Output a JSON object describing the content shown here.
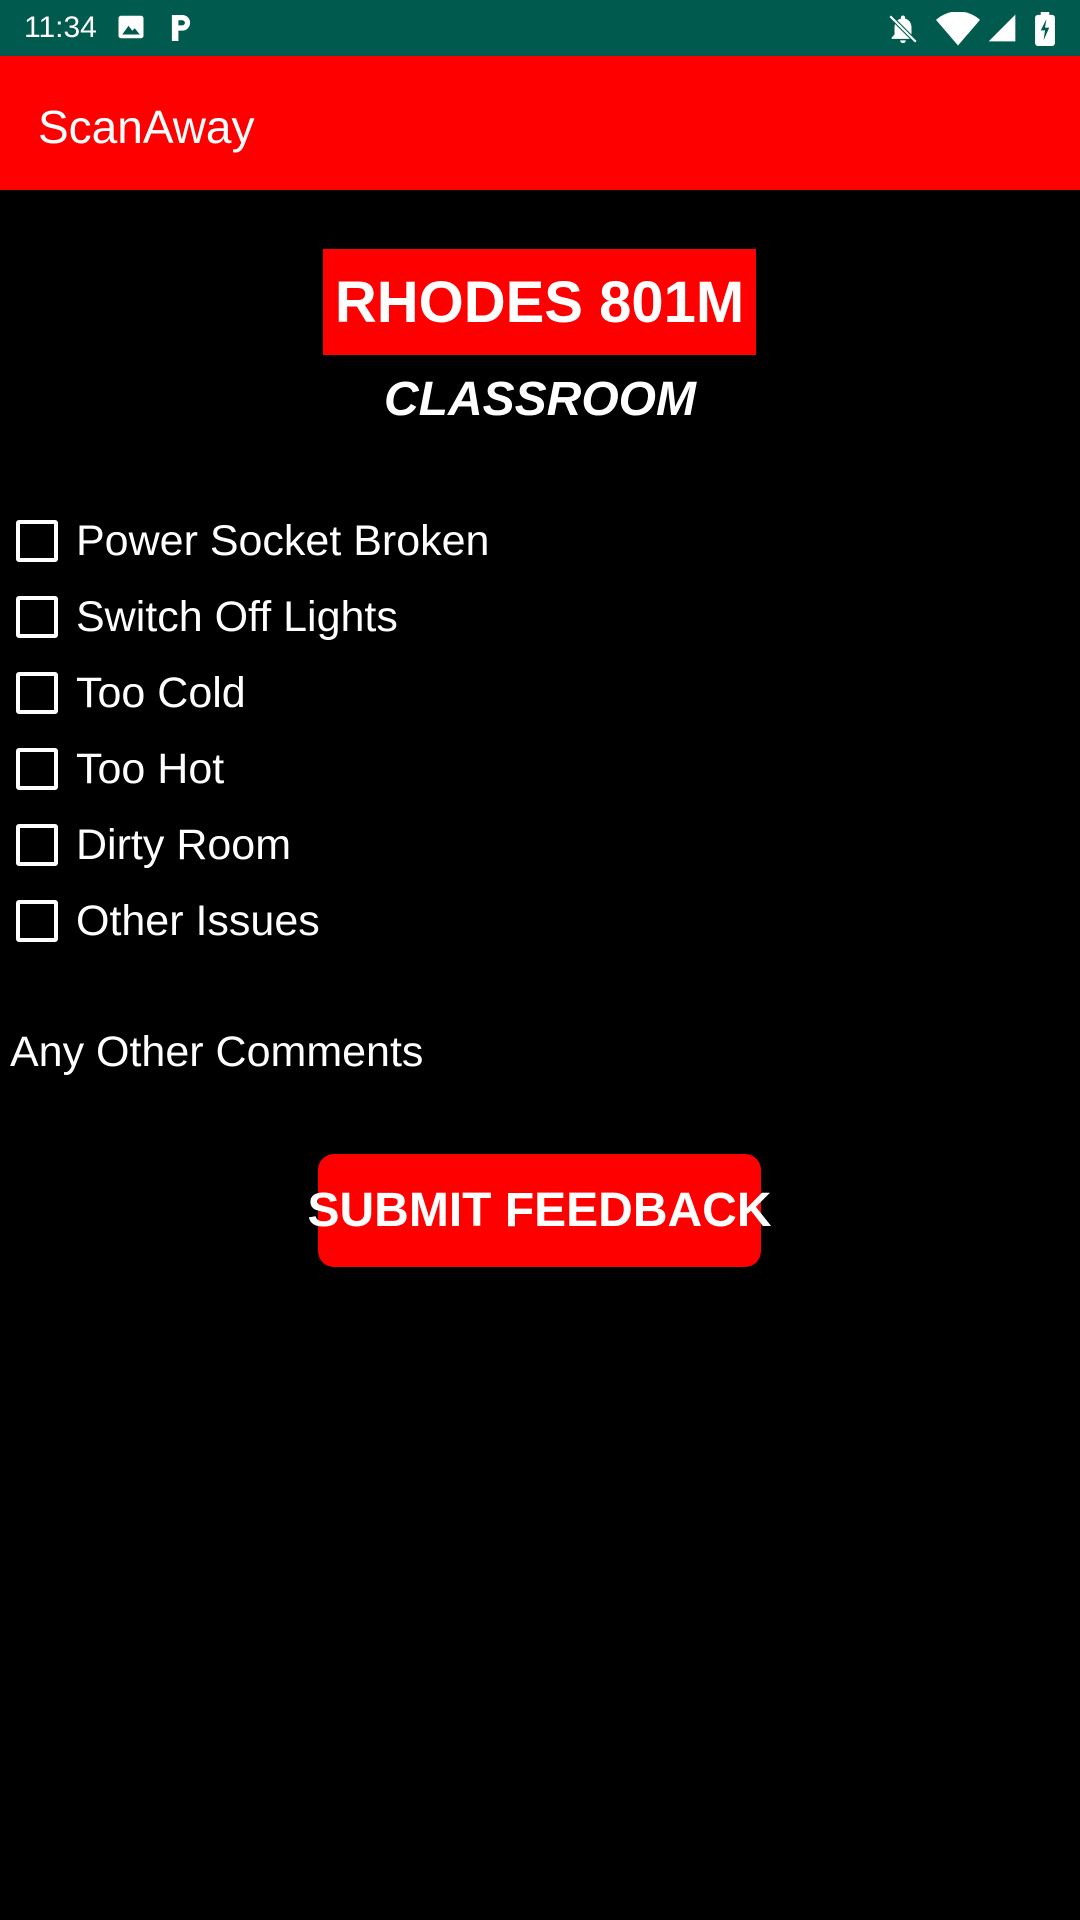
{
  "status_bar": {
    "time": "11:34",
    "left_icons": [
      "image-icon",
      "parking-p-icon"
    ],
    "right_icons": [
      "notifications-off-icon",
      "wifi-icon",
      "signal-icon",
      "battery-charging-icon"
    ],
    "background": "#005a4d"
  },
  "app_bar": {
    "title": "ScanAway",
    "background": "#ff0000"
  },
  "room": {
    "name": "RHODES 801M",
    "type": "CLASSROOM"
  },
  "issues": [
    {
      "label": "Power Socket Broken",
      "checked": false
    },
    {
      "label": "Switch Off Lights",
      "checked": false
    },
    {
      "label": "Too Cold",
      "checked": false
    },
    {
      "label": "Too Hot",
      "checked": false
    },
    {
      "label": "Dirty Room",
      "checked": false
    },
    {
      "label": "Other Issues",
      "checked": false
    }
  ],
  "comments_label": "Any Other Comments",
  "submit_label": "SUBMIT FEEDBACK",
  "colors": {
    "accent": "#ff0000",
    "background": "#000000",
    "text": "#ffffff"
  }
}
